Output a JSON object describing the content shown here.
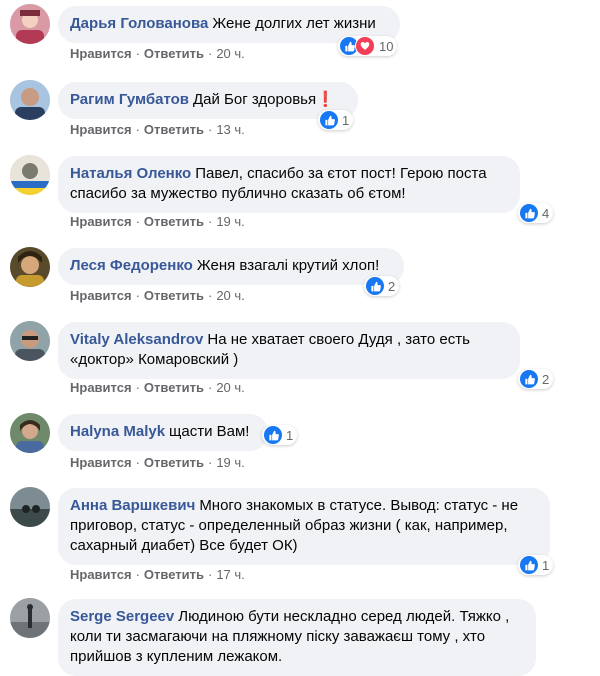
{
  "comments": [
    {
      "author": "Дарья Голованова",
      "text": "Жене долгих лет жизни",
      "like": "Нравится",
      "reply": "Ответить",
      "time": "20 ч.",
      "reactions": [
        "like",
        "love"
      ],
      "reaction_count": "10"
    },
    {
      "author": "Рагим Гумбатов",
      "text": "Дай Бог здоровья",
      "emoji": "❗",
      "like": "Нравится",
      "reply": "Ответить",
      "time": "13 ч.",
      "reactions": [
        "like"
      ],
      "reaction_count": "1"
    },
    {
      "author": "Наталья Оленко",
      "text": "Павел, спасибо за єтот пост! Герою поста спасибо за мужество публично сказать об єтом!",
      "like": "Нравится",
      "reply": "Ответить",
      "time": "19 ч.",
      "reactions": [
        "like"
      ],
      "reaction_count": "4"
    },
    {
      "author": "Леся Федоренко",
      "text": "Женя взагалі крутий хлоп!",
      "like": "Нравится",
      "reply": "Ответить",
      "time": "20 ч.",
      "reactions": [
        "like"
      ],
      "reaction_count": "2"
    },
    {
      "author": "Vitaly Aleksandrov",
      "text": "На не хватает своего Дудя , зато есть «доктор» Комаровский )",
      "like": "Нравится",
      "reply": "Ответить",
      "time": "20 ч.",
      "reactions": [
        "like"
      ],
      "reaction_count": "2"
    },
    {
      "author": "Halyna Malyk",
      "text": "щасти Вам!",
      "like": "Нравится",
      "reply": "Ответить",
      "time": "19 ч.",
      "reactions": [
        "like"
      ],
      "reaction_count": "1"
    },
    {
      "author": "Анна Варшкевич",
      "text": "Много знакомых в статусе. Вывод: статус - не приговор, статус - определенный образ жизни ( как, например, сахарный диабет) Все будет ОК)",
      "like": "Нравится",
      "reply": "Ответить",
      "time": "17 ч.",
      "reactions": [
        "like"
      ],
      "reaction_count": "1"
    },
    {
      "author": "Serge Sergeev",
      "text": "Людиною бути нескладно серед людей. Тяжко , коли ти засмагаючи на пляжному піску заважаєш тому , хто прийшов з купленим лежаком."
    }
  ],
  "ui": {
    "author_color": "#385898",
    "bubble_color": "#f0f2f5",
    "like_color": "#1877f2",
    "love_color": "#f33e58",
    "meta_separator": "·"
  }
}
